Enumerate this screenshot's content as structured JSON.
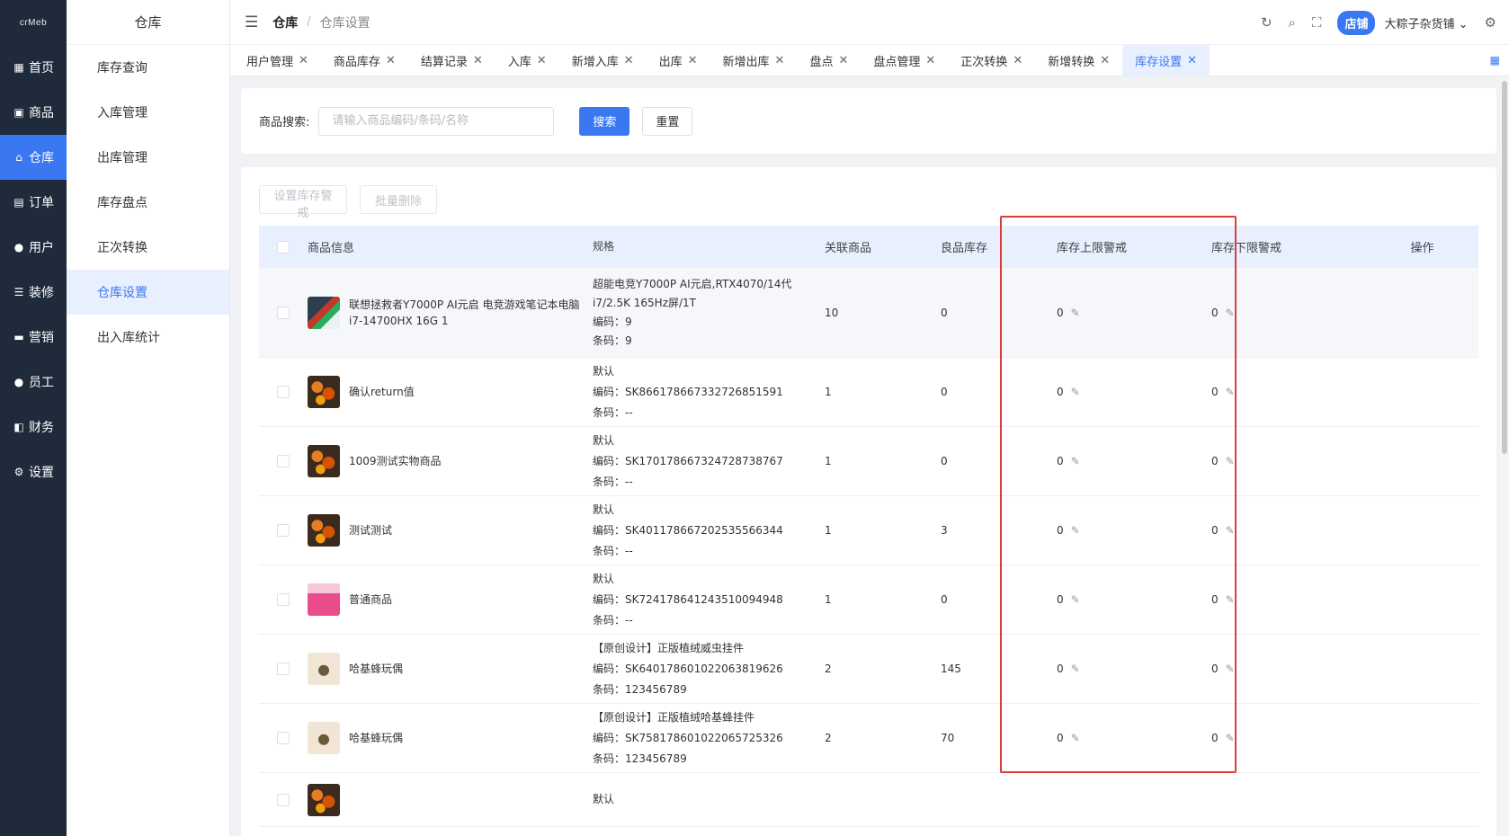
{
  "nav": {
    "logo": "crMeb",
    "items": [
      {
        "label": "首页",
        "icon": "grid-icon"
      },
      {
        "label": "商品",
        "icon": "bag-icon"
      },
      {
        "label": "仓库",
        "icon": "warehouse-icon"
      },
      {
        "label": "订单",
        "icon": "order-icon"
      },
      {
        "label": "用户",
        "icon": "user-icon"
      },
      {
        "label": "装修",
        "icon": "sliders-icon"
      },
      {
        "label": "营销",
        "icon": "marketing-icon"
      },
      {
        "label": "员工",
        "icon": "staff-icon"
      },
      {
        "label": "财务",
        "icon": "finance-icon"
      },
      {
        "label": "设置",
        "icon": "gear-icon"
      }
    ]
  },
  "submenu": {
    "title": "仓库",
    "items": [
      "库存查询",
      "入库管理",
      "出库管理",
      "库存盘点",
      "正次转换",
      "仓库设置",
      "出入库统计"
    ]
  },
  "header": {
    "breadcrumb_current": "仓库",
    "breadcrumb_sub": "仓库设置",
    "shop_badge": "店铺",
    "shop_name": "大粽子杂货铺"
  },
  "tabs": [
    "用户管理",
    "商品库存",
    "结算记录",
    "入库",
    "新增入库",
    "出库",
    "新增出库",
    "盘点",
    "盘点管理",
    "正次转换",
    "新增转换",
    "库存设置"
  ],
  "search": {
    "label": "商品搜索:",
    "placeholder": "请输入商品编码/条码/名称",
    "search_btn": "搜索",
    "reset_btn": "重置"
  },
  "toolbar": {
    "set_warning": "设置库存警戒",
    "batch_delete": "批量删除"
  },
  "table": {
    "headers": [
      "商品信息",
      "规格",
      "关联商品",
      "良品库存",
      "库存上限警戒",
      "库存下限警戒",
      "操作"
    ],
    "rows": [
      {
        "name": "联想拯救者Y7000P AI元启 电竞游戏笔记本电脑i7-14700HX 16G 1",
        "img": "laptop",
        "spec": "超能电竞Y7000P AI元启,RTX4070/14代i7/2.5K 165Hz屏/1T",
        "code": "编码：9",
        "barcode": "条码：9",
        "related": "10",
        "stock": "0",
        "upper": "0",
        "lower": "0"
      },
      {
        "name": "确认return值",
        "img": "food",
        "spec": "默认",
        "code": "编码：SK866178667332726851591",
        "barcode": "条码：--",
        "related": "1",
        "stock": "0",
        "upper": "0",
        "lower": "0"
      },
      {
        "name": "1009测试实物商品",
        "img": "food",
        "spec": "默认",
        "code": "编码：SK170178667324728738767",
        "barcode": "条码：--",
        "related": "1",
        "stock": "0",
        "upper": "0",
        "lower": "0"
      },
      {
        "name": "测试测试",
        "img": "food",
        "spec": "默认",
        "code": "编码：SK401178667202535566344",
        "barcode": "条码：--",
        "related": "1",
        "stock": "3",
        "upper": "0",
        "lower": "0"
      },
      {
        "name": "普通商品",
        "img": "pink",
        "spec": "默认",
        "code": "编码：SK724178641243510094948",
        "barcode": "条码：--",
        "related": "1",
        "stock": "0",
        "upper": "0",
        "lower": "0"
      },
      {
        "name": "哈基蜂玩偶",
        "img": "toy",
        "spec": "【原创设计】正版植绒威虫挂件",
        "code": "编码：SK640178601022063819626",
        "barcode": "条码：123456789",
        "related": "2",
        "stock": "145",
        "upper": "0",
        "lower": "0"
      },
      {
        "name": "哈基蜂玩偶",
        "img": "toy",
        "spec": "【原创设计】正版植绒哈基蜂挂件",
        "code": "编码：SK758178601022065725326",
        "barcode": "条码：123456789",
        "related": "2",
        "stock": "70",
        "upper": "0",
        "lower": "0"
      },
      {
        "name": "",
        "img": "food",
        "spec": "默认",
        "code": "",
        "barcode": "",
        "related": "",
        "stock": "",
        "upper": "",
        "lower": ""
      }
    ]
  },
  "colors": {
    "primary": "#3a78f2",
    "nav_bg": "#1f2a3b",
    "highlight_box": "#e03c3c"
  }
}
